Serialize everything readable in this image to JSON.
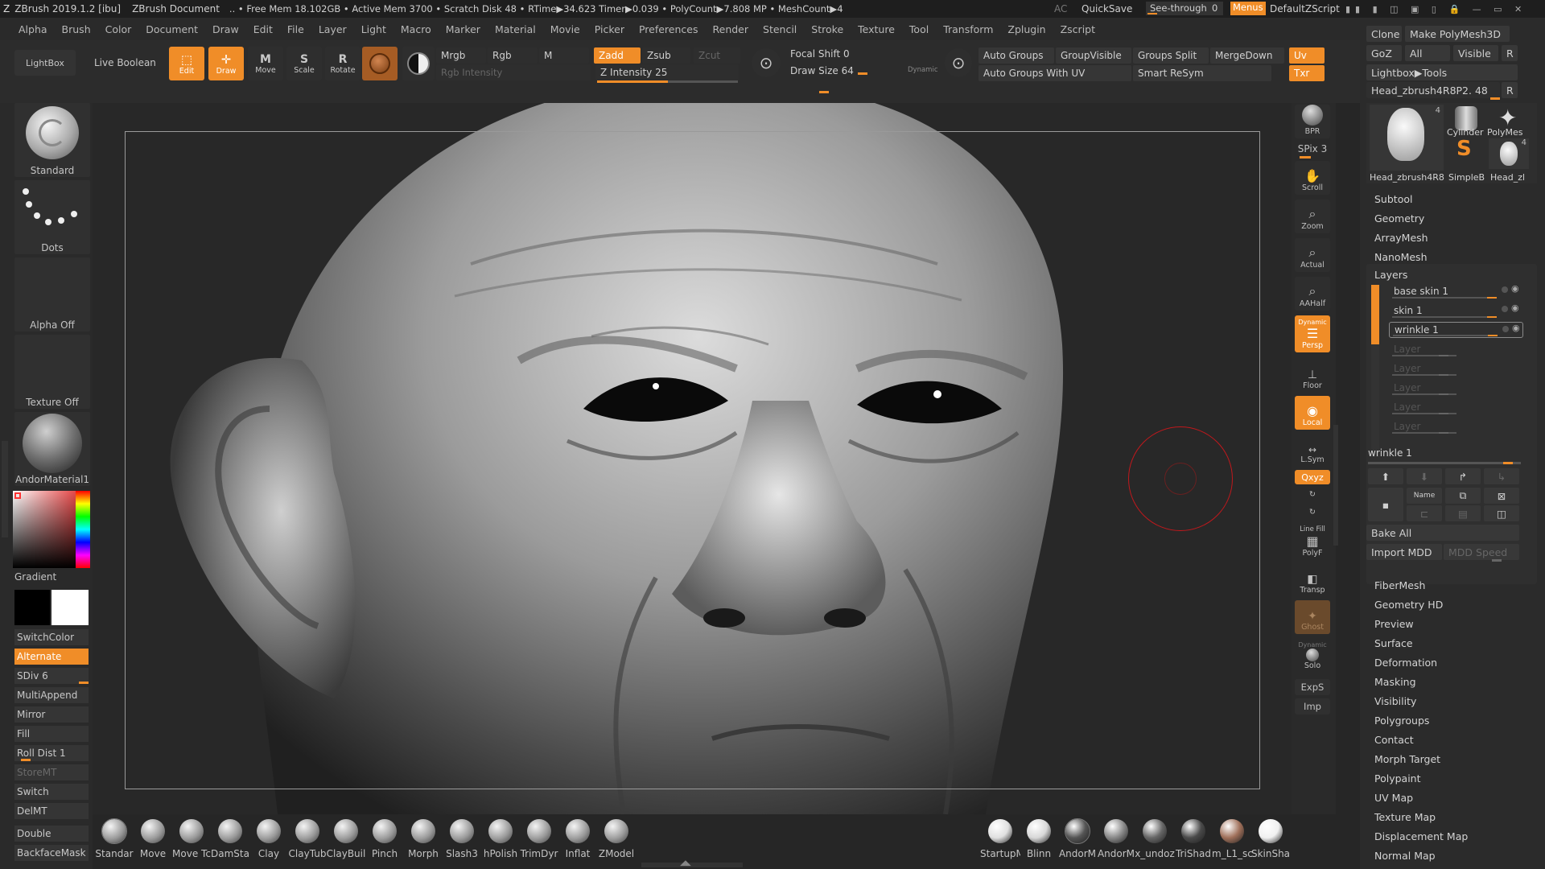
{
  "titlebar": {
    "app": "ZBrush 2019.1.2 [ibu]",
    "document": "ZBrush Document",
    "stats": ".. • Free Mem 18.102GB • Active Mem 3700 • Scratch Disk 48 • RTime▶34.623 Timer▶0.039 • PolyCount▶7.808 MP • MeshCount▶4",
    "ac": "AC",
    "quicksave": "QuickSave",
    "seethrough": "See-through",
    "seethrough_value": "0",
    "menus": "Menus",
    "default_script": "DefaultZScript"
  },
  "menubar": [
    "Alpha",
    "Brush",
    "Color",
    "Document",
    "Draw",
    "Edit",
    "File",
    "Layer",
    "Light",
    "Macro",
    "Marker",
    "Material",
    "Movie",
    "Picker",
    "Preferences",
    "Render",
    "Stencil",
    "Stroke",
    "Texture",
    "Tool",
    "Transform",
    "Zplugin",
    "Zscript"
  ],
  "toolbar": {
    "lightbox": "LightBox",
    "live_boolean": "Live Boolean",
    "edit": "Edit",
    "draw": "Draw",
    "move": "Move",
    "scale": "Scale",
    "rotate": "Rotate",
    "mrgb": "Mrgb",
    "rgb": "Rgb",
    "m": "M",
    "zadd": "Zadd",
    "zsub": "Zsub",
    "zcut": "Zcut",
    "rgb_intensity": "Rgb Intensity",
    "z_intensity": "Z Intensity 25",
    "z_intensity_value": 25,
    "focal_shift": "Focal Shift 0",
    "draw_size": "Draw Size 64",
    "draw_size_value": 64,
    "dynamic": "Dynamic",
    "auto_groups": "Auto Groups",
    "group_visible": "GroupVisible",
    "groups_split": "Groups Split",
    "merge_down": "MergeDown",
    "uv": "Uv",
    "auto_groups_uv": "Auto Groups With UV",
    "smart_resym": "Smart ReSym",
    "txr": "Txr"
  },
  "leftpanel": {
    "brush": "Standard",
    "stroke": "Dots",
    "alpha": "Alpha Off",
    "texture": "Texture Off",
    "material": "AndorMaterial1",
    "gradient": "Gradient",
    "switchcolor": "SwitchColor",
    "alternate": "Alternate",
    "sdiv": "SDiv 6",
    "sdiv_value": 6,
    "multiappend": "MultiAppend",
    "mirror": "Mirror",
    "fill": "Fill",
    "roll_dist": "Roll Dist 1",
    "storemt": "StoreMT",
    "switch": "Switch",
    "delmt": "DelMT",
    "double": "Double",
    "backfacemask": "BackfaceMask"
  },
  "rightstrip": {
    "bpr": "BPR",
    "spix": "SPix 3",
    "scroll": "Scroll",
    "zoom": "Zoom",
    "actual": "Actual",
    "aahalf": "AAHalf",
    "dynamic": "Dynamic",
    "persp": "Persp",
    "floor": "Floor",
    "local": "Local",
    "lsym": "L.Sym",
    "xyz": "Qxyz",
    "line_fill": "Line Fill",
    "polyf": "PolyF",
    "transp": "Transp",
    "ghost": "Ghost",
    "solo": "Solo",
    "exps": "ExpS",
    "imp": "Imp"
  },
  "toolpanel": {
    "clone": "Clone",
    "make_polymesh": "Make PolyMesh3D",
    "goz": "GoZ",
    "all": "All",
    "visible": "Visible",
    "r": "R",
    "lightbox_tools": "Lightbox▶Tools",
    "current_tool": "Head_zbrush4R8P2. 48",
    "thumbs": [
      {
        "label": "Head_zbrush4R8",
        "badge": "4"
      },
      {
        "label": "Cylinder",
        "badge": ""
      },
      {
        "label": "PolyMes",
        "badge": ""
      },
      {
        "label": "SimpleB",
        "badge": ""
      },
      {
        "label": "Head_zl",
        "badge": "4"
      }
    ],
    "sections_top": [
      "Subtool",
      "Geometry",
      "ArrayMesh",
      "NanoMesh"
    ],
    "layers_title": "Layers",
    "layers": [
      {
        "name": "base skin 1",
        "active": true
      },
      {
        "name": "skin 1",
        "active": true
      },
      {
        "name": "wrinkle 1",
        "active": true
      },
      {
        "name": "Layer",
        "active": false
      },
      {
        "name": "Layer",
        "active": false
      },
      {
        "name": "Layer",
        "active": false
      },
      {
        "name": "Layer",
        "active": false
      },
      {
        "name": "Layer",
        "active": false
      }
    ],
    "current_layer": "wrinkle 1",
    "name_btn": "Name",
    "bake_all": "Bake All",
    "import_mdd": "Import MDD",
    "mdd_speed": "MDD Speed",
    "sections_bottom": [
      "FiberMesh",
      "Geometry HD",
      "Preview",
      "Surface",
      "Deformation",
      "Masking",
      "Visibility",
      "Polygroups",
      "Contact",
      "Morph Target",
      "Polypaint",
      "UV Map",
      "Texture Map",
      "Displacement Map",
      "Normal Map"
    ]
  },
  "bottomshelf": {
    "brushes": [
      "Standar",
      "Move",
      "Move Tc",
      "DamSta",
      "Clay",
      "ClayTub",
      "ClayBuil",
      "Pinch",
      "Morph",
      "Slash3",
      "hPolish",
      "TrimDyr",
      "Inflat",
      "ZModel"
    ],
    "materials": [
      "StartupM",
      "Blinn",
      "AndorM",
      "AndorM",
      "x_undoz",
      "TriShad",
      "m_L1_sc",
      "SkinSha"
    ]
  },
  "colors": {
    "accent": "#f08d28",
    "panel": "#2b2b2b",
    "canvas": "#282828",
    "cursor_ring": "#c0181c"
  }
}
